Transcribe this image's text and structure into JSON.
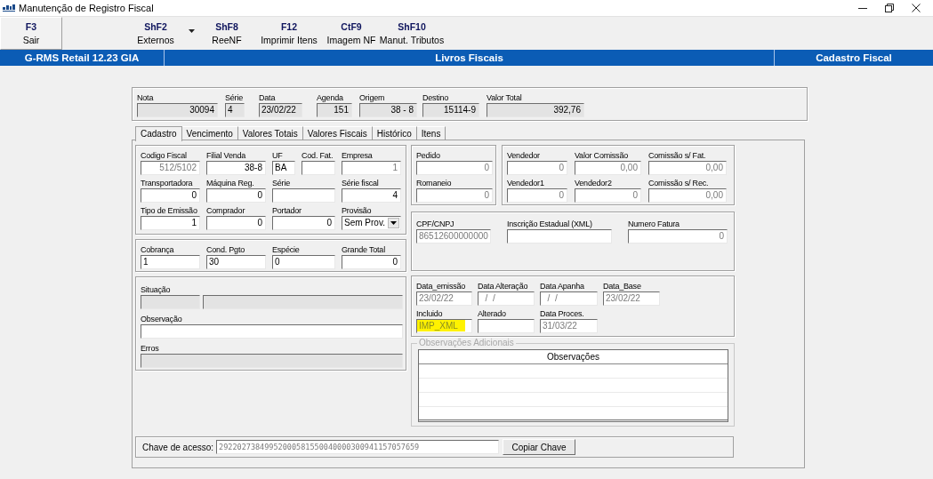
{
  "window": {
    "title": "Manutenção de Registro Fiscal"
  },
  "toolbar": [
    {
      "key": "F3",
      "label": "Sair",
      "focused": true,
      "dropdown": false
    },
    {
      "key": "ShF2",
      "label": "Externos",
      "focused": false,
      "dropdown": true
    },
    {
      "key": "ShF8",
      "label": "ReeNF",
      "focused": false,
      "dropdown": false
    },
    {
      "key": "F12",
      "label": "Imprimir Itens",
      "focused": false,
      "dropdown": false
    },
    {
      "key": "CtF9",
      "label": "Imagem NF",
      "focused": false,
      "dropdown": false
    },
    {
      "key": "ShF10",
      "label": "Manut. Tributos",
      "focused": false,
      "dropdown": false
    }
  ],
  "banner": {
    "product": "G-RMS Retail 12.23 GIA",
    "module": "Livros Fiscais",
    "screen": "Cadastro Fiscal"
  },
  "header_fields": [
    {
      "label": "Nota",
      "value": "30094"
    },
    {
      "label": "Série",
      "value": "4"
    },
    {
      "label": "Data",
      "value": "23/02/22"
    },
    {
      "label": "Agenda",
      "value": "151"
    },
    {
      "label": "Origem",
      "value": "38 - 8"
    },
    {
      "label": "Destino",
      "value": "15114-9"
    },
    {
      "label": "Valor Total",
      "value": "392,76"
    }
  ],
  "tabs": [
    {
      "label": "Cadastro",
      "selected": true
    },
    {
      "label": "Vencimento",
      "selected": false
    },
    {
      "label": "Valores Totais",
      "selected": false
    },
    {
      "label": "Valores Fiscais",
      "selected": false
    },
    {
      "label": "Histórico",
      "selected": false
    },
    {
      "label": "Itens",
      "selected": false
    }
  ],
  "left_groups": [
    {
      "rows": [
        [
          {
            "label": "Codigo Fiscal",
            "value": "512/5102",
            "kind": "disabled"
          },
          {
            "label": "Filial Venda",
            "value": "38-8",
            "kind": "input"
          },
          {
            "label": "UF",
            "value": "BA",
            "kind": "input"
          },
          {
            "label": "Cod. Fat.",
            "kind": "input"
          },
          {
            "label": "Empresa",
            "value": "1",
            "kind": "disabled"
          }
        ],
        [
          {
            "label": "Transportadora",
            "value": "0",
            "kind": "input"
          },
          {
            "label": "Máquina Reg.",
            "value": "0",
            "kind": "input"
          },
          {
            "label": "Série",
            "kind": "input"
          },
          {
            "label": "Série fiscal",
            "value": "4",
            "kind": "input"
          }
        ],
        [
          {
            "label": "Tipo de Emissão",
            "value": "1",
            "kind": "input"
          },
          {
            "label": "Comprador",
            "value": "0",
            "kind": "input"
          },
          {
            "label": "Portador",
            "value": "0",
            "kind": "input"
          },
          {
            "label": "Provisão",
            "value": "Sem Prov.",
            "kind": "select"
          }
        ]
      ]
    },
    {
      "rows": [
        [
          {
            "label": "Cobrança",
            "value": "1",
            "kind": "input"
          },
          {
            "label": "Cond. Pgto",
            "value": "30",
            "kind": "input"
          },
          {
            "label": "Espécie",
            "value": "0",
            "kind": "input"
          },
          {
            "label": "Grande Total",
            "value": "0",
            "kind": "input"
          }
        ]
      ]
    },
    {
      "rows": [
        [
          {
            "label": "Situação",
            "kind": "readonly"
          },
          {
            "kind": "readonly"
          }
        ],
        [
          {
            "label": "Observação",
            "kind": "input"
          }
        ],
        [
          {
            "label": "Erros",
            "kind": "readonly"
          }
        ]
      ]
    }
  ],
  "right_top_groups": [
    {
      "rows": [
        [
          {
            "label": "Pedido",
            "value": "0",
            "kind": "disabled"
          }
        ],
        [
          {
            "label": "Romaneio",
            "value": "0",
            "kind": "disabled"
          }
        ]
      ]
    },
    {
      "rows": [
        [
          {
            "label": "Vendedor",
            "value": "0",
            "kind": "disabled"
          },
          {
            "label": "Valor Comissão",
            "value": "0,00",
            "kind": "disabled"
          },
          {
            "label": "Comissão s/ Fat.",
            "value": "0,00",
            "kind": "disabled"
          }
        ],
        [
          {
            "label": "Vendedor1",
            "value": "0",
            "kind": "disabled"
          },
          {
            "label": "Vendedor2",
            "value": "0",
            "kind": "disabled"
          },
          {
            "label": "Comissão s/ Rec.",
            "value": "0,00",
            "kind": "disabled"
          }
        ]
      ]
    }
  ],
  "right_groups": [
    {
      "rows": [
        [
          {
            "label": "CPF/CNPJ",
            "value": "86512600000000",
            "kind": "disabled"
          },
          {
            "label": "Inscrição Estadual (XML)",
            "kind": "disabled"
          },
          {
            "label": "Numero Fatura",
            "value": "0",
            "kind": "disabled"
          }
        ]
      ]
    },
    {
      "rows": [
        [
          {
            "label": "Data_emissão",
            "value": "23/02/22",
            "kind": "disabled"
          },
          {
            "label": "Data Alteração",
            "value": "  /  /",
            "kind": "disabled"
          },
          {
            "label": "Data Apanha",
            "value": "  /  /",
            "kind": "disabled"
          },
          {
            "label": "Data_Base",
            "value": "23/02/22",
            "kind": "disabled"
          }
        ],
        [
          {
            "label": "Incluido",
            "value": "IMP_XML",
            "kind": "highlighted"
          },
          {
            "label": "Alterado",
            "kind": "disabled"
          },
          {
            "label": "Data Proces.",
            "value": "31/03/22",
            "kind": "disabled"
          }
        ]
      ]
    }
  ],
  "observacoes": {
    "legend": "Observações Adicionais",
    "disabled": true,
    "columns": [
      "Observações"
    ]
  },
  "chave": {
    "label": "Chave de acesso:",
    "value": "29220273849952000581550040000300941157057659",
    "button": "Copiar Chave"
  }
}
